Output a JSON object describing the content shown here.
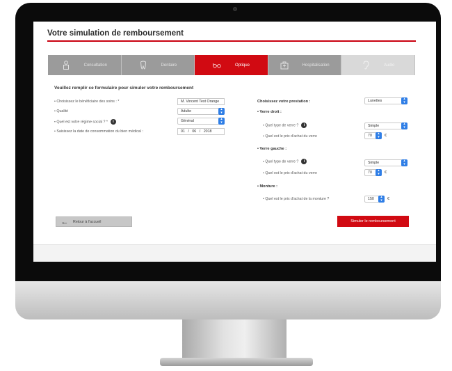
{
  "page": {
    "title": "Votre simulation de remboursement"
  },
  "tabs": [
    {
      "label": "Consultation",
      "icon": "doctor-icon",
      "state": "inactive"
    },
    {
      "label": "Dentaire",
      "icon": "tooth-icon",
      "state": "inactive"
    },
    {
      "label": "Optique",
      "icon": "glasses-icon",
      "state": "active"
    },
    {
      "label": "Hospitalisation",
      "icon": "hospital-icon",
      "state": "inactive"
    },
    {
      "label": "Audio",
      "icon": "ear-icon",
      "state": "disabled"
    }
  ],
  "form": {
    "heading": "Veuillez remplir ce formulaire pour simuler votre remboursement",
    "beneficiary_label": "• Choisissez le bénéficiaire des soins : *",
    "beneficiary_value": "M. Vincent Test Orange",
    "quality_label": "• Qualité",
    "quality_value": "Adulte",
    "regime_label": "• Quel est votre régime social ? *",
    "regime_value": "Général",
    "date_label": "• Saisissez la date de consommation du bien médical :",
    "date_day": "01",
    "date_month": "06",
    "date_year": "2018"
  },
  "prestation": {
    "label": "Choisissez votre prestation :",
    "value": "Lunettes",
    "right_lens_heading": "• Verre droit :",
    "right_type_label": "• Quel type de verre ?",
    "right_type_value": "Simple",
    "right_price_label": "• Quel est le prix d'achat du verre",
    "right_price_value": "70",
    "left_lens_heading": "• Verre gauche :",
    "left_type_label": "• Quel type de verre ?",
    "left_type_value": "Simple",
    "left_price_label": "• Quel est le prix d'achat du verre",
    "left_price_value": "70",
    "frame_heading": "• Monture :",
    "frame_price_label": "• Quel est le prix d'achat de la monture ?",
    "frame_price_value": "150",
    "currency": "€"
  },
  "actions": {
    "back_label": "Retour à l'accueil",
    "simulate_label": "Simuler le remboursement"
  },
  "colors": {
    "accent": "#d10a12",
    "tab_inactive": "#9b9b9b",
    "tab_disabled": "#d9d9d9",
    "select_arrow": "#2f7ee6"
  }
}
